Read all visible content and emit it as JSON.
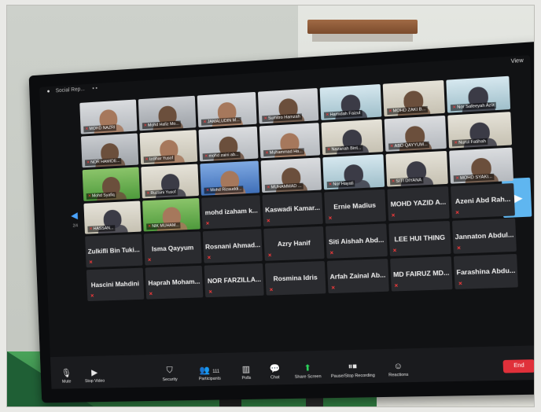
{
  "window": {
    "title": "Social Rep...",
    "view_label": "View"
  },
  "icons": {
    "logo": "zoom-logo",
    "mic": "mic-icon",
    "video": "video-icon"
  },
  "video_tiles": [
    {
      "label": "MOHD NAZRI",
      "style": "v2",
      "person": "light"
    },
    {
      "label": "Mohd Hafiz Mo...",
      "style": "video",
      "person": ""
    },
    {
      "label": "JAMALUDIN M...",
      "style": "v2",
      "person": "light"
    },
    {
      "label": "Sumitro Hamzah",
      "style": "v2",
      "person": ""
    },
    {
      "label": "Hamidah Faizul",
      "style": "v6",
      "person": "hijab"
    },
    {
      "label": "MOHD ZAKI B...",
      "style": "v5",
      "person": ""
    },
    {
      "label": "Nor Safeeyah Aziz",
      "style": "v6",
      "person": "hijab"
    },
    {
      "label": "NOR HAMIDE...",
      "style": "video",
      "person": ""
    },
    {
      "label": "Izdihar Yusof",
      "style": "v5",
      "person": "light"
    },
    {
      "label": "mohd zaini ab...",
      "style": "v2",
      "person": ""
    },
    {
      "label": "Muhammad Ha...",
      "style": "v2",
      "person": "light"
    },
    {
      "label": "Nazariah Bint...",
      "style": "v5",
      "person": "hijab"
    },
    {
      "label": "ABD QAYYUM...",
      "style": "v2",
      "person": ""
    },
    {
      "label": "Nurul Fatihah",
      "style": "v5",
      "person": "hijab"
    },
    {
      "label": "Mohd Syafiq",
      "style": "v4",
      "person": ""
    },
    {
      "label": "Ruzaini Yusof",
      "style": "v5",
      "person": "hijab"
    },
    {
      "label": "Mohd Rizauddi...",
      "style": "v3",
      "person": "light"
    },
    {
      "label": "MUHAMMAD ...",
      "style": "v2",
      "person": ""
    },
    {
      "label": "Nor Hayati",
      "style": "v6",
      "person": "hijab"
    },
    {
      "label": "SITI DIYANA",
      "style": "v5",
      "person": "hijab"
    },
    {
      "label": "MOHD SYAKI...",
      "style": "v2",
      "person": ""
    },
    {
      "label": "HASSAN...",
      "style": "v5",
      "person": "hijab"
    },
    {
      "label": "NIK MUHAM...",
      "style": "v4",
      "person": "light"
    }
  ],
  "name_tiles": [
    "mohd izaham k...",
    "Kaswadi Kamar...",
    "Ernie Madius",
    "MOHD YAZID A...",
    "Azeni Abd Rah...",
    "Zulkifli Bin Tuki...",
    "Isma Qayyum",
    "Rosnani Ahmad...",
    "Azry Hanif",
    "Siti Aishah Abd...",
    "LEE HUI THING",
    "Jannaton Abdul...",
    "Hascini Mahdini",
    "Haprah Moham...",
    "NOR FARZILLA...",
    "Rosmina Idris",
    "Arfah Zainal Ab...",
    "MD FAIRUZ MD...",
    "Farashina Abdu..."
  ],
  "navigation": {
    "prev": "◀",
    "next": "▶",
    "page": "2/4"
  },
  "toolbar": {
    "mute": "Mute",
    "stop_video": "Stop Video",
    "security": "Security",
    "participants": "Participants",
    "participants_count": "111",
    "polls": "Polls",
    "chat": "Chat",
    "share_screen": "Share Screen",
    "record": "Pause/Stop Recording",
    "reactions": "Reactions",
    "end": "End"
  },
  "colors": {
    "end": "#e0303a",
    "share": "#2bd45a",
    "next": "#5fb6f0",
    "muted": "#ff3b3b"
  }
}
